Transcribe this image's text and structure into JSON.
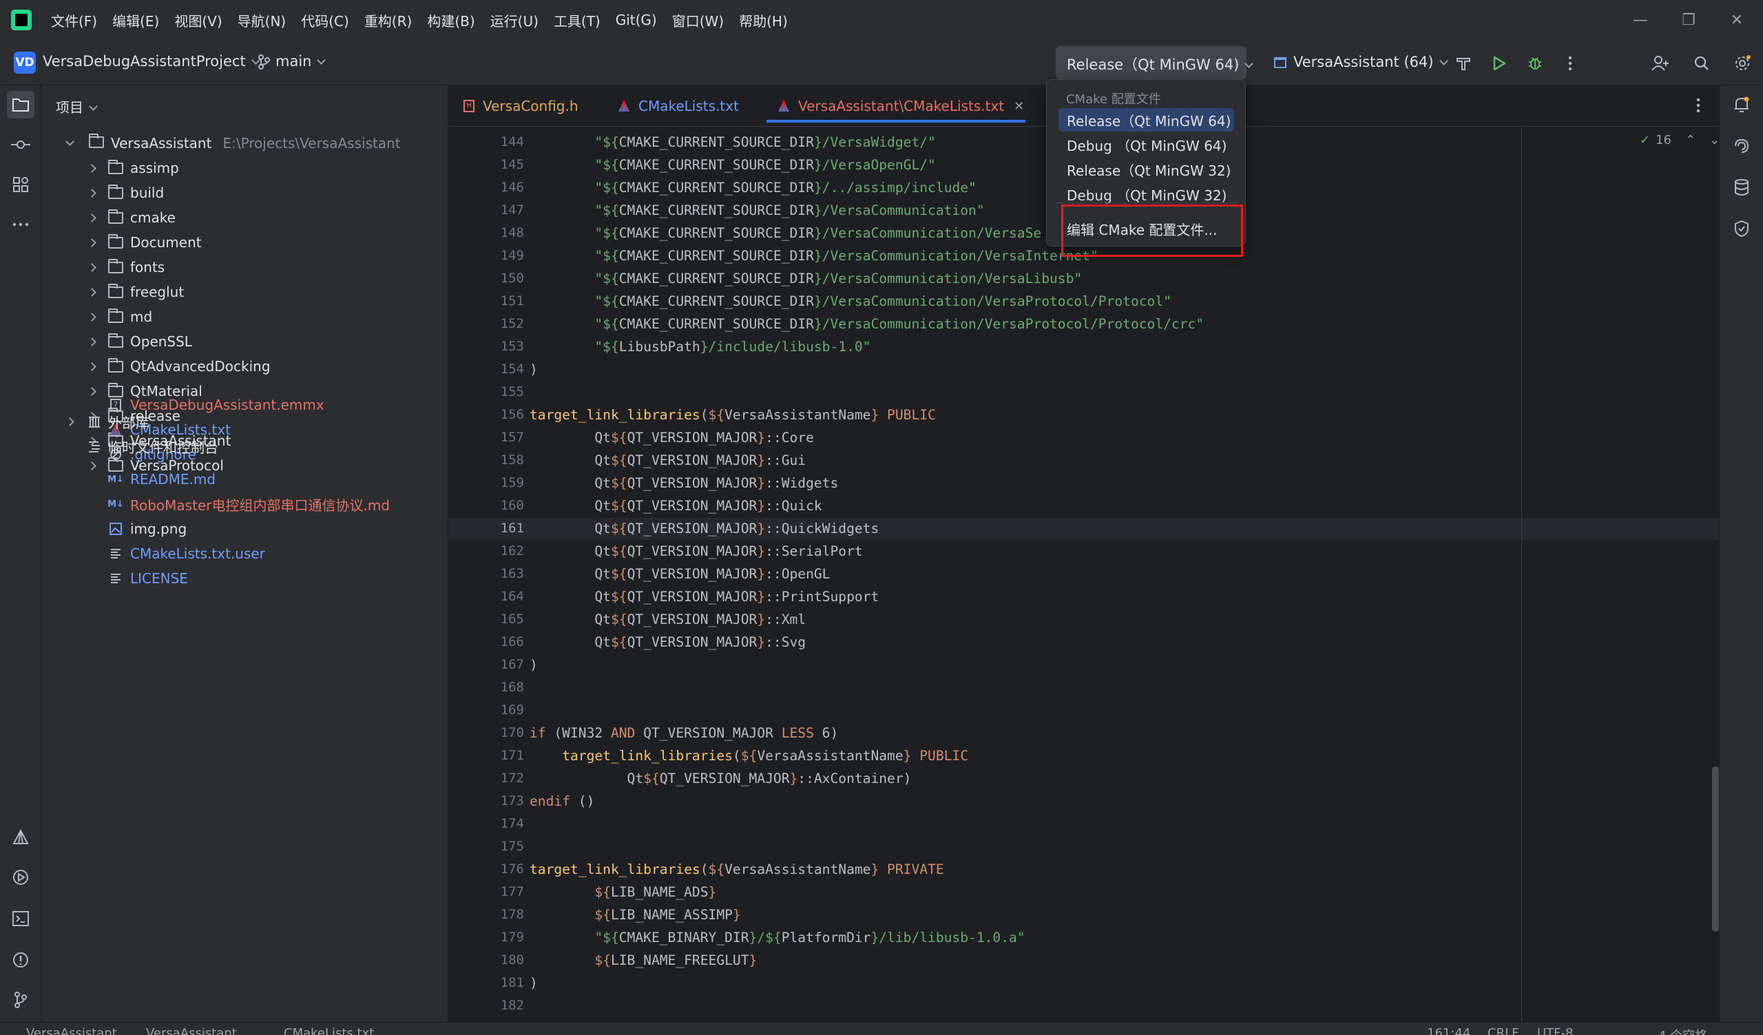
{
  "menubar": {
    "items": [
      "文件(F)",
      "编辑(E)",
      "视图(V)",
      "导航(N)",
      "代码(C)",
      "重构(R)",
      "构建(B)",
      "运行(U)",
      "工具(T)",
      "Git(G)",
      "窗口(W)",
      "帮助(H)"
    ]
  },
  "toolbar": {
    "project_badge": "VD",
    "project_name": "VersaDebugAssistantProject",
    "branch": "main",
    "config": "Release（Qt MinGW 64)",
    "run_target": "VersaAssistant (64)"
  },
  "project_panel": {
    "title": "项目",
    "root": {
      "name": "VersaAssistant",
      "path": "E:\\Projects\\VersaAssistant"
    },
    "folders": [
      "assimp",
      "build",
      "cmake",
      "Document",
      "fonts",
      "freeglut",
      "md",
      "OpenSSL",
      "QtAdvancedDocking",
      "QtMaterial",
      "release",
      "VersaAssistant",
      "VersaProtocol"
    ],
    "files": [
      {
        "name": "VersaDebugAssistant.emmx",
        "color": "red",
        "icon": "unknown-file-icon"
      },
      {
        "name": "CMakeLists.txt",
        "color": "blue",
        "icon": "cmake-icon"
      },
      {
        "name": ".gitignore",
        "color": "blue",
        "icon": "ignore-file-icon"
      },
      {
        "name": "README.md",
        "color": "blue",
        "icon": "markdown-icon"
      },
      {
        "name": "RoboMaster电控组内部串口通信协议.md",
        "color": "red",
        "icon": "markdown-icon"
      },
      {
        "name": "img.png",
        "color": "default",
        "icon": "image-icon"
      },
      {
        "name": "CMakeLists.txt.user",
        "color": "blue",
        "icon": "text-file-icon"
      },
      {
        "name": "LICENSE",
        "color": "blue",
        "icon": "text-file-icon"
      }
    ],
    "external_libs": "外部库",
    "scratches": "临时文件和控制台"
  },
  "tabs": [
    {
      "label": "VersaConfig.h",
      "color": "#e0a95a",
      "icon": "header-file-icon"
    },
    {
      "label": "CMakeLists.txt",
      "color": "#6e9dff",
      "icon": "cmake-icon"
    },
    {
      "label": "VersaAssistant\\CMakeLists.txt",
      "color": "#e67064",
      "icon": "cmake-icon",
      "active": true
    }
  ],
  "editor": {
    "inspection_count": "16",
    "current_line": 161,
    "lines": [
      {
        "n": "144",
        "segs": [
          [
            "        ",
            ""
          ],
          [
            "\"${",
            "str"
          ],
          [
            "CMAKE_CURRENT_SOURCE_DIR",
            "var"
          ],
          [
            "}/VersaWidget/\"",
            "str"
          ]
        ]
      },
      {
        "n": "145",
        "segs": [
          [
            "        ",
            ""
          ],
          [
            "\"${",
            "str"
          ],
          [
            "CMAKE_CURRENT_SOURCE_DIR",
            "var"
          ],
          [
            "}/VersaOpenGL/\"",
            "str"
          ]
        ]
      },
      {
        "n": "146",
        "segs": [
          [
            "        ",
            ""
          ],
          [
            "\"${",
            "str"
          ],
          [
            "CMAKE_CURRENT_SOURCE_DIR",
            "var"
          ],
          [
            "}/../assimp/include\"",
            "str"
          ]
        ]
      },
      {
        "n": "147",
        "segs": [
          [
            "        ",
            ""
          ],
          [
            "\"${",
            "str"
          ],
          [
            "CMAKE_CURRENT_SOURCE_DIR",
            "var"
          ],
          [
            "}/VersaCommunication\"",
            "str"
          ]
        ]
      },
      {
        "n": "148",
        "segs": [
          [
            "        ",
            ""
          ],
          [
            "\"${",
            "str"
          ],
          [
            "CMAKE_CURRENT_SOURCE_DIR",
            "var"
          ],
          [
            "}/VersaCommunication/VersaSe",
            "str"
          ]
        ]
      },
      {
        "n": "149",
        "segs": [
          [
            "        ",
            ""
          ],
          [
            "\"${",
            "str"
          ],
          [
            "CMAKE_CURRENT_SOURCE_DIR",
            "var"
          ],
          [
            "}/VersaCommunication/VersaInternet\"",
            "str"
          ]
        ]
      },
      {
        "n": "150",
        "segs": [
          [
            "        ",
            ""
          ],
          [
            "\"${",
            "str"
          ],
          [
            "CMAKE_CURRENT_SOURCE_DIR",
            "var"
          ],
          [
            "}/VersaCommunication/VersaLibusb\"",
            "str"
          ]
        ]
      },
      {
        "n": "151",
        "segs": [
          [
            "        ",
            ""
          ],
          [
            "\"${",
            "str"
          ],
          [
            "CMAKE_CURRENT_SOURCE_DIR",
            "var"
          ],
          [
            "}/VersaCommunication/VersaProtocol/Protocol\"",
            "str"
          ]
        ]
      },
      {
        "n": "152",
        "segs": [
          [
            "        ",
            ""
          ],
          [
            "\"${",
            "str"
          ],
          [
            "CMAKE_CURRENT_SOURCE_DIR",
            "var"
          ],
          [
            "}/VersaCommunication/VersaProtocol/Protocol/crc\"",
            "str"
          ]
        ]
      },
      {
        "n": "153",
        "segs": [
          [
            "        ",
            ""
          ],
          [
            "\"${",
            "str"
          ],
          [
            "LibusbPath",
            "var"
          ],
          [
            "}/include/libusb-1.0\"",
            "str"
          ]
        ]
      },
      {
        "n": "154",
        "segs": [
          [
            ")",
            ""
          ]
        ]
      },
      {
        "n": "155",
        "segs": []
      },
      {
        "n": "156",
        "segs": [
          [
            "target_link_libraries",
            "fn"
          ],
          [
            "(",
            ""
          ],
          [
            "${",
            "curly"
          ],
          [
            "VersaAssistantName",
            ""
          ],
          [
            "}",
            "curly"
          ],
          [
            " PUBLIC",
            "kw"
          ]
        ]
      },
      {
        "n": "157",
        "segs": [
          [
            "        Qt",
            ""
          ],
          [
            "${",
            "curly"
          ],
          [
            "QT_VERSION_MAJOR",
            ""
          ],
          [
            "}",
            "curly"
          ],
          [
            "::Core",
            ""
          ]
        ]
      },
      {
        "n": "158",
        "segs": [
          [
            "        Qt",
            ""
          ],
          [
            "${",
            "curly"
          ],
          [
            "QT_VERSION_MAJOR",
            ""
          ],
          [
            "}",
            "curly"
          ],
          [
            "::Gui",
            ""
          ]
        ]
      },
      {
        "n": "159",
        "segs": [
          [
            "        Qt",
            ""
          ],
          [
            "${",
            "curly"
          ],
          [
            "QT_VERSION_MAJOR",
            ""
          ],
          [
            "}",
            "curly"
          ],
          [
            "::Widgets",
            ""
          ]
        ]
      },
      {
        "n": "160",
        "segs": [
          [
            "        Qt",
            ""
          ],
          [
            "${",
            "curly"
          ],
          [
            "QT_VERSION_MAJOR",
            ""
          ],
          [
            "}",
            "curly"
          ],
          [
            "::Quick",
            ""
          ]
        ]
      },
      {
        "n": "161",
        "segs": [
          [
            "        Qt",
            ""
          ],
          [
            "${",
            "curly"
          ],
          [
            "QT_VERSION_MAJOR",
            ""
          ],
          [
            "}",
            "curly"
          ],
          [
            "::QuickWidgets",
            ""
          ]
        ]
      },
      {
        "n": "162",
        "segs": [
          [
            "        Qt",
            ""
          ],
          [
            "${",
            "curly"
          ],
          [
            "QT_VERSION_MAJOR",
            ""
          ],
          [
            "}",
            "curly"
          ],
          [
            "::SerialPort",
            ""
          ]
        ]
      },
      {
        "n": "163",
        "segs": [
          [
            "        Qt",
            ""
          ],
          [
            "${",
            "curly"
          ],
          [
            "QT_VERSION_MAJOR",
            ""
          ],
          [
            "}",
            "curly"
          ],
          [
            "::OpenGL",
            ""
          ]
        ]
      },
      {
        "n": "164",
        "segs": [
          [
            "        Qt",
            ""
          ],
          [
            "${",
            "curly"
          ],
          [
            "QT_VERSION_MAJOR",
            ""
          ],
          [
            "}",
            "curly"
          ],
          [
            "::PrintSupport",
            ""
          ]
        ]
      },
      {
        "n": "165",
        "segs": [
          [
            "        Qt",
            ""
          ],
          [
            "${",
            "curly"
          ],
          [
            "QT_VERSION_MAJOR",
            ""
          ],
          [
            "}",
            "curly"
          ],
          [
            "::Xml",
            ""
          ]
        ]
      },
      {
        "n": "166",
        "segs": [
          [
            "        Qt",
            ""
          ],
          [
            "${",
            "curly"
          ],
          [
            "QT_VERSION_MAJOR",
            ""
          ],
          [
            "}",
            "curly"
          ],
          [
            "::Svg",
            ""
          ]
        ]
      },
      {
        "n": "167",
        "segs": [
          [
            ")",
            ""
          ]
        ]
      },
      {
        "n": "168",
        "segs": []
      },
      {
        "n": "169",
        "segs": []
      },
      {
        "n": "170",
        "segs": [
          [
            "if",
            "kw"
          ],
          [
            " (WIN32 ",
            ""
          ],
          [
            "AND",
            "kw"
          ],
          [
            " QT_VERSION_MAJOR ",
            ""
          ],
          [
            "LESS",
            "kw"
          ],
          [
            " 6)",
            ""
          ]
        ]
      },
      {
        "n": "171",
        "segs": [
          [
            "    ",
            ""
          ],
          [
            "target_link_libraries",
            "fn"
          ],
          [
            "(",
            ""
          ],
          [
            "${",
            "curly"
          ],
          [
            "VersaAssistantName",
            ""
          ],
          [
            "}",
            "curly"
          ],
          [
            " PUBLIC",
            "kw"
          ]
        ]
      },
      {
        "n": "172",
        "segs": [
          [
            "            Qt",
            ""
          ],
          [
            "${",
            "curly"
          ],
          [
            "QT_VERSION_MAJOR",
            ""
          ],
          [
            "}",
            "curly"
          ],
          [
            "::AxContainer)",
            ""
          ]
        ]
      },
      {
        "n": "173",
        "segs": [
          [
            "endif",
            "kw"
          ],
          [
            " ()",
            ""
          ]
        ]
      },
      {
        "n": "174",
        "segs": []
      },
      {
        "n": "175",
        "segs": []
      },
      {
        "n": "176",
        "segs": [
          [
            "target_link_libraries",
            "fn"
          ],
          [
            "(",
            ""
          ],
          [
            "${",
            "curly"
          ],
          [
            "VersaAssistantName",
            ""
          ],
          [
            "}",
            "curly"
          ],
          [
            " PRIVATE",
            "kw"
          ]
        ]
      },
      {
        "n": "177",
        "segs": [
          [
            "        ",
            ""
          ],
          [
            "${",
            "curly"
          ],
          [
            "LIB_NAME_ADS",
            ""
          ],
          [
            "}",
            "curly"
          ]
        ]
      },
      {
        "n": "178",
        "segs": [
          [
            "        ",
            ""
          ],
          [
            "${",
            "curly"
          ],
          [
            "LIB_NAME_ASSIMP",
            ""
          ],
          [
            "}",
            "curly"
          ]
        ]
      },
      {
        "n": "179",
        "segs": [
          [
            "        ",
            ""
          ],
          [
            "\"${",
            "str"
          ],
          [
            "CMAKE_BINARY_DIR",
            "var"
          ],
          [
            "}/",
            "str"
          ],
          [
            "${",
            "str"
          ],
          [
            "PlatformDir",
            "var"
          ],
          [
            "}/lib/libusb-1.0.a\"",
            "str"
          ]
        ]
      },
      {
        "n": "180",
        "segs": [
          [
            "        ",
            ""
          ],
          [
            "${",
            "curly"
          ],
          [
            "LIB_NAME_FREEGLUT",
            ""
          ],
          [
            "}",
            "curly"
          ]
        ]
      },
      {
        "n": "181",
        "segs": [
          [
            ")",
            ""
          ]
        ]
      },
      {
        "n": "182",
        "segs": []
      }
    ]
  },
  "dropdown": {
    "header": "CMake 配置文件",
    "items": [
      "Release（Qt MinGW 64)",
      "Debug （Qt MinGW 64)",
      "Release（Qt MinGW 32)",
      "Debug （Qt MinGW 32)"
    ],
    "selected_index": 0,
    "edit_label": "编辑 CMake 配置文件..."
  },
  "statusbar": {
    "breadcrumb": [
      "VersaAssistant",
      "VersaAssistant",
      "CMakeLists.txt"
    ],
    "position": "161:44",
    "line_sep": "CRLF",
    "encoding": "UTF-8",
    "indent": "4 个空格"
  },
  "colors": {
    "accent": "#3574f0",
    "highlight_box": "#e5201f"
  }
}
